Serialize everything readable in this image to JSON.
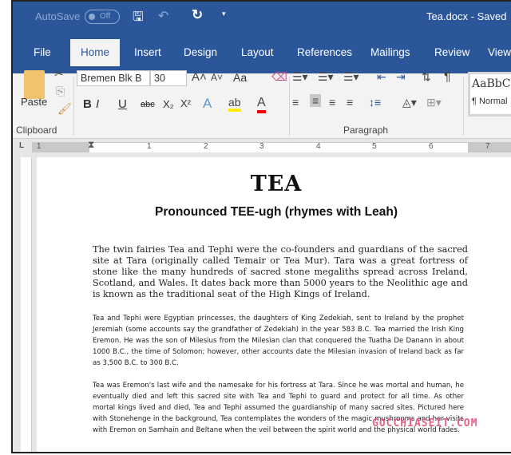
{
  "titlebar": {
    "autosave": "AutoSave",
    "toggle": "Off",
    "doc_title": "Tea.docx - Saved"
  },
  "tabs": [
    "File",
    "Home",
    "Insert",
    "Design",
    "Layout",
    "References",
    "Mailings",
    "Review",
    "View"
  ],
  "ribbon": {
    "paste": "Paste",
    "font_name": "Bremen Blk B",
    "font_size": "30",
    "change_case": "Aa",
    "bold": "B",
    "italic": "I",
    "underline": "U",
    "strike": "abc",
    "subscript": "X₂",
    "superscript": "X²",
    "style_preview": "AaBbC",
    "style_name": "¶ Normal",
    "groups": {
      "clipboard": "Clipboard",
      "paragraph": "Paragraph"
    }
  },
  "ruler": {
    "marks": [
      "1",
      "1",
      "2",
      "3",
      "4",
      "5",
      "6",
      "7"
    ]
  },
  "document": {
    "title": "TEA",
    "subtitle": "Pronounced TEE-ugh (rhymes with Leah)",
    "paragraphs": [
      "The twin fairies Tea and Tephi were the co-founders and guardians of the sacred site at Tara (originally called Temair or Tea Mur). Tara was a great fortress of stone like the many hundreds of sacred stone megaliths spread across Ireland, Scotland, and Wales. It dates back more than 5000 years to the Neolithic age and is known as the traditional seat of the High Kings of Ireland.",
      "Tea and Tephi were Egyptian princesses, the daughters of King Zedekiah, sent to Ireland by the prophet Jeremiah (some accounts say the grandfather of Zedekiah) in the year 583 B.C. Tea married the Irish King Eremon. He was the son of Milesius from the Milesian clan that conquered the Tuatha De Danann in about 1000 B.C., the time of Solomon; however, other accounts date the Milesian invasion of Ireland back as far as 3,500 B.C. to 300 B.C.",
      "Tea was Eremon's last wife and the namesake for his fortress at Tara. Since he was mortal and human, he eventually died and left this sacred site with Tea and Tephi to guard and protect for all time. As other mortal kings lived and died, Tea and Tephi assumed the guardianship of many sacred sites. Pictured here with Stonehenge in the background, Tea contemplates the wonders of the magic mushrooms and her visits with Eremon on Samhain and Beltane when the veil between the spirit world and the physical world fades."
    ]
  },
  "watermark": "GOCCHIASEIT.COM",
  "colors": {
    "accent": "#2b579a"
  }
}
